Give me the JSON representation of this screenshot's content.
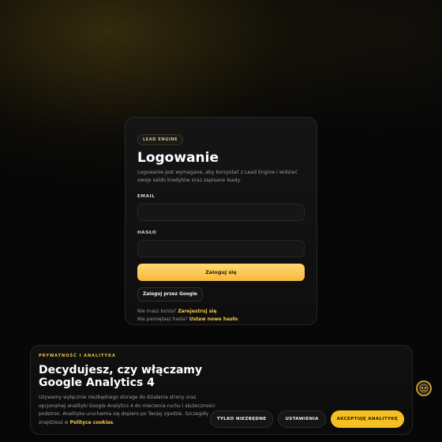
{
  "login": {
    "badge": "LEAD ENGINE",
    "title": "Logowanie",
    "description": "Logowanie jest wymagane, aby korzystać z Lead Engine i widzieć swoje saldo kredytów oraz zapisane leady.",
    "email_label": "EMAIL",
    "email_value": "",
    "password_label": "HASŁO",
    "password_value": "",
    "submit_label": "Zaloguj się",
    "google_label": "Zaloguj przez Google",
    "register_prompt": "Nie masz konta?",
    "register_link": "Zarejestruj się",
    "reset_prompt": "Nie pamiętasz hasła?",
    "reset_link": "Ustaw nowe hasło"
  },
  "cookie": {
    "eyebrow": "PRYWATNOŚĆ I ANALITYKA",
    "title": "Decydujesz, czy włączamy Google Analytics 4",
    "text": "Używamy wyłącznie niezbędnego storage do działania strony oraz opcjonalnej analityki Google Analytics 4 do mierzenia ruchu i skuteczności podstron. Analityka uruchamia się dopiero po Twojej zgodzie. Szczegóły znajdziesz w",
    "policy_link": "Polityce cookies",
    "text_end": ".",
    "buttons": {
      "necessary": "TYLKO NIEZBĘDNE",
      "settings": "USTAWIENIA",
      "accept": "AKCEPTUJĘ ANALITYKĘ"
    }
  },
  "colors": {
    "accent": "#f5c022",
    "background": "#070707",
    "card": "#111111"
  },
  "icons": {
    "assistant": "assistant-avatar-icon"
  }
}
